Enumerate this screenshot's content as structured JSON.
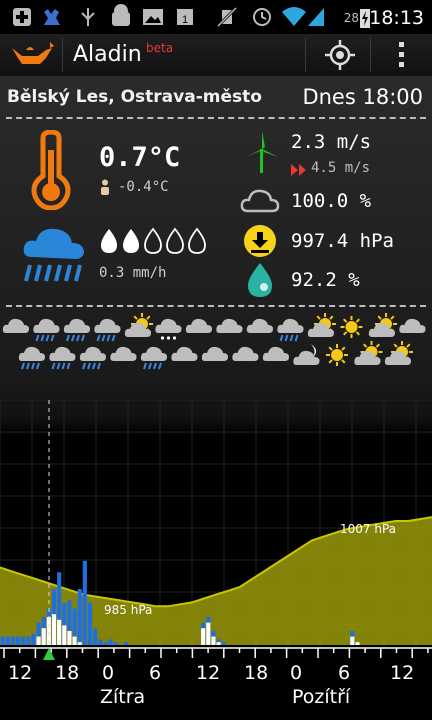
{
  "status_bar": {
    "time": "18:13",
    "battery": "28",
    "icons": [
      "add-icon",
      "deer-icon",
      "usb-icon",
      "android-icon",
      "image-icon",
      "calendar-icon",
      "mute-icon",
      "alarm-icon",
      "wifi-icon",
      "signal-icon",
      "battery-charging-icon"
    ]
  },
  "app": {
    "title": "Aladin",
    "badge": "beta",
    "actions": [
      "location-icon",
      "overflow-menu-icon"
    ]
  },
  "location": {
    "name": "Bělský Les, Ostrava-město",
    "time": "Dnes 18:00"
  },
  "current": {
    "temperature": "0.7°C",
    "feels_like": "-0.4°C",
    "precip_rate": "0.3 mm/h",
    "precip_level": 2,
    "precip_max": 5,
    "wind_speed": "2.3 m/s",
    "wind_gust": "4.5 m/s",
    "cloudiness": "100.0 %",
    "pressure": "997.4 hPa",
    "humidity": "92.2 %"
  },
  "forecast_icons": {
    "row1": [
      "cloud",
      "cloud-rain",
      "cloud-rain",
      "cloud-rain",
      "sun-cloud",
      "cloud-snow",
      "cloud",
      "cloud",
      "cloud",
      "cloud-rain",
      "sun-cloud",
      "sun",
      "sun-cloud",
      "cloud"
    ],
    "row2": [
      "cloud-rain",
      "cloud-rain",
      "cloud-rain",
      "cloud",
      "cloud-rain",
      "cloud",
      "cloud",
      "cloud",
      "cloud",
      "moon-cloud",
      "sun",
      "sun-cloud",
      "sun-cloud"
    ]
  },
  "chart_data": {
    "type": "area",
    "pressure_labels": [
      "985 hPa",
      "1007 hPa"
    ],
    "x_ticks": [
      "12",
      "18",
      "0",
      "6",
      "12",
      "18",
      "0",
      "6",
      "12"
    ],
    "day_labels": [
      "Zítra",
      "Pozítří"
    ],
    "pressure": [
      995,
      994,
      993,
      992,
      991,
      990,
      989,
      988,
      987.5,
      987,
      986.5,
      986,
      985.5,
      985,
      985,
      985.5,
      986,
      987,
      988,
      989,
      990,
      992,
      994,
      996,
      998,
      1000,
      1002,
      1003,
      1004,
      1005,
      1005.5,
      1006,
      1006.5,
      1007,
      1007,
      1007.5,
      1008
    ],
    "precip_total": [
      0.3,
      0.3,
      0.3,
      0.3,
      0.3,
      0.3,
      0.4,
      0.8,
      1.0,
      1.3,
      2.0,
      2.6,
      1.5,
      1.6,
      1.3,
      2.0,
      3.0,
      1.5,
      0.6,
      0.2,
      0.1,
      0.2,
      0.1,
      0.0,
      0.1,
      0.0,
      0.0,
      0.0,
      0.0,
      0.0,
      0.0,
      0.0,
      0.0,
      0.0,
      0.0,
      0.0,
      0.0,
      0.0,
      0.0,
      0.8,
      1.0,
      0.5,
      0.2,
      0.1,
      0.0,
      0.0,
      0.0,
      0.0,
      0.0,
      0.0,
      0.0,
      0.0,
      0.0,
      0.0,
      0.0,
      0.0,
      0.0,
      0.0,
      0.0,
      0.0,
      0.0,
      0.0,
      0.0,
      0.0,
      0.0,
      0.0,
      0.0,
      0.0,
      0.5,
      0.1,
      0.0,
      0.0,
      0.0,
      0.0,
      0.0,
      0.0,
      0.0,
      0.0,
      0.0,
      0.0,
      0.0,
      0.0,
      0.0,
      0.0
    ],
    "precip_snow": [
      0.0,
      0.0,
      0.0,
      0.0,
      0.0,
      0.0,
      0.0,
      0.3,
      0.6,
      1.0,
      1.1,
      0.9,
      0.7,
      0.5,
      0.3,
      0.1,
      0.0,
      0.0,
      0.0,
      0.0,
      0.0,
      0.0,
      0.0,
      0.0,
      0.0,
      0.0,
      0.0,
      0.0,
      0.0,
      0.0,
      0.0,
      0.0,
      0.0,
      0.0,
      0.0,
      0.0,
      0.0,
      0.0,
      0.0,
      0.6,
      0.8,
      0.3,
      0.1,
      0.0,
      0.0,
      0.0,
      0.0,
      0.0,
      0.0,
      0.0,
      0.0,
      0.0,
      0.0,
      0.0,
      0.0,
      0.0,
      0.0,
      0.0,
      0.0,
      0.0,
      0.0,
      0.0,
      0.0,
      0.0,
      0.0,
      0.0,
      0.0,
      0.0,
      0.3,
      0.1,
      0.0,
      0.0,
      0.0,
      0.0,
      0.0,
      0.0,
      0.0,
      0.0,
      0.0,
      0.0,
      0.0,
      0.0,
      0.0,
      0.0
    ]
  }
}
